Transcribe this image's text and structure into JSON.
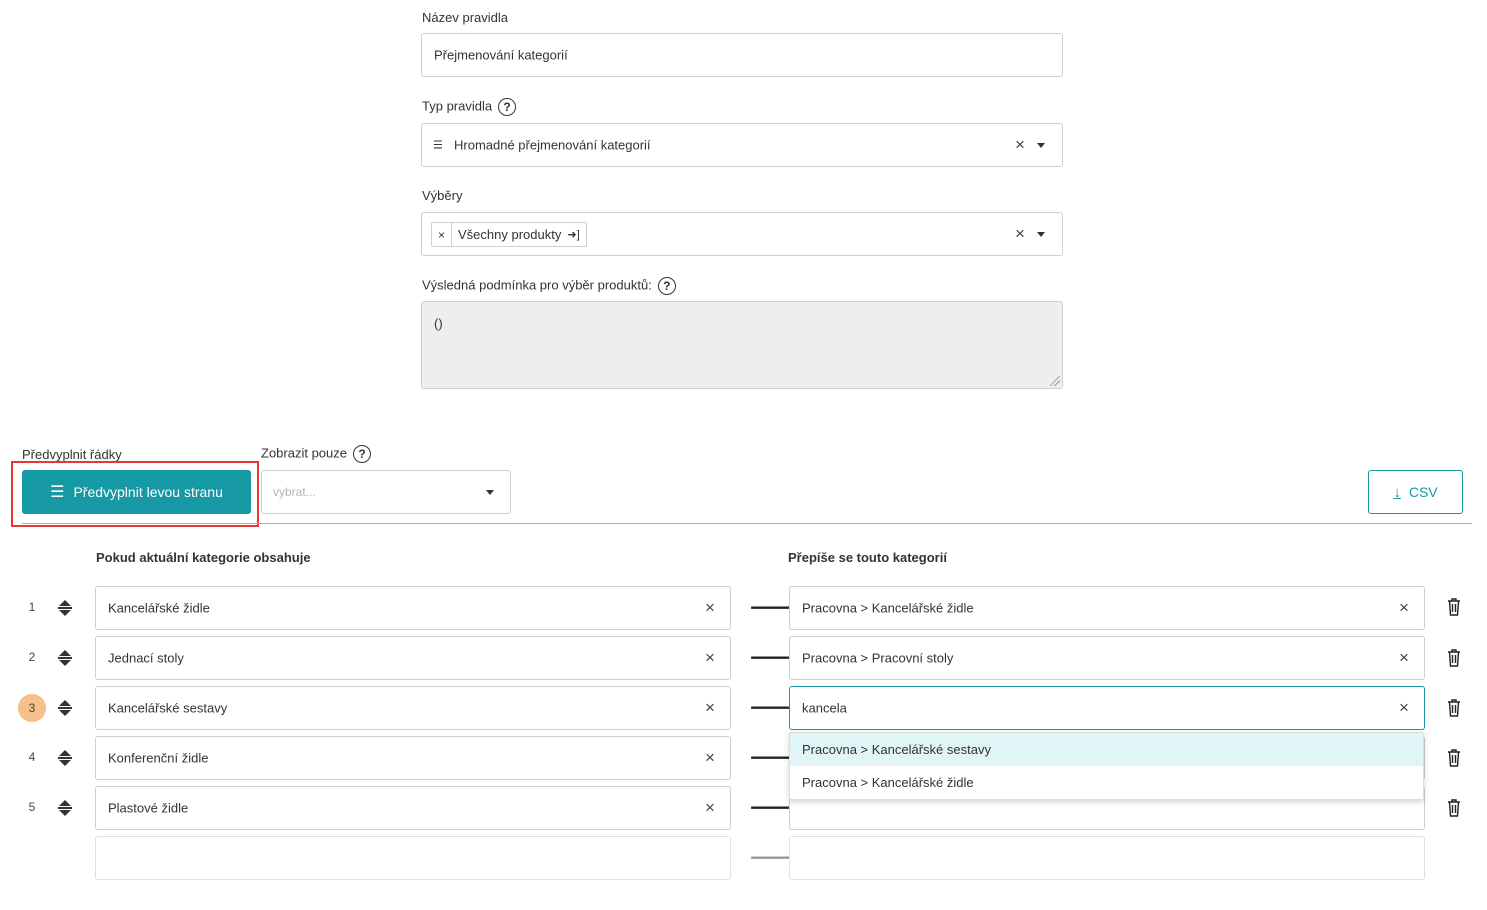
{
  "form": {
    "rule_name_label": "Název pravidla",
    "rule_name_value": "Přejmenování kategorií",
    "rule_type_label": "Typ pravidla",
    "rule_type_icon": "list-icon",
    "rule_type_value": "Hromadné přejmenování kategorií",
    "selections_label": "Výběry",
    "selection_tag": "Všechny produkty",
    "condition_label": "Výsledná podmínka pro výběr produktů:",
    "condition_value": "()"
  },
  "toolbar": {
    "prefill_label": "Předvyplnit řádky",
    "prefill_button": "Předvyplnit levou stranu",
    "show_only_label": "Zobrazit pouze",
    "show_only_placeholder": "vybrat...",
    "csv_button": "CSV",
    "accent_color": "#1699a5"
  },
  "table": {
    "left_header": "Pokud aktuální kategorie obsahuje",
    "right_header": "Přepíše se touto kategorií",
    "rows": [
      {
        "num": "1",
        "source": "Kancelářské židle",
        "target": "Pracovna > Kancelářské židle"
      },
      {
        "num": "2",
        "source": "Jednací stoly",
        "target": "Pracovna > Pracovní stoly"
      },
      {
        "num": "3",
        "source": "Kancelářské sestavy",
        "target": "kancela"
      },
      {
        "num": "4",
        "source": "Konferenční židle",
        "target": ""
      },
      {
        "num": "5",
        "source": "Plastové židle",
        "target": ""
      }
    ],
    "active_row_color": "#f6c08a"
  },
  "autocomplete": {
    "options": [
      "Pracovna > Kancelářské sestavy",
      "Pracovna > Kancelářské židle"
    ]
  },
  "glyphs": {
    "clear": "×",
    "arrow": "🡒",
    "close_tag": "×",
    "help": "?"
  }
}
